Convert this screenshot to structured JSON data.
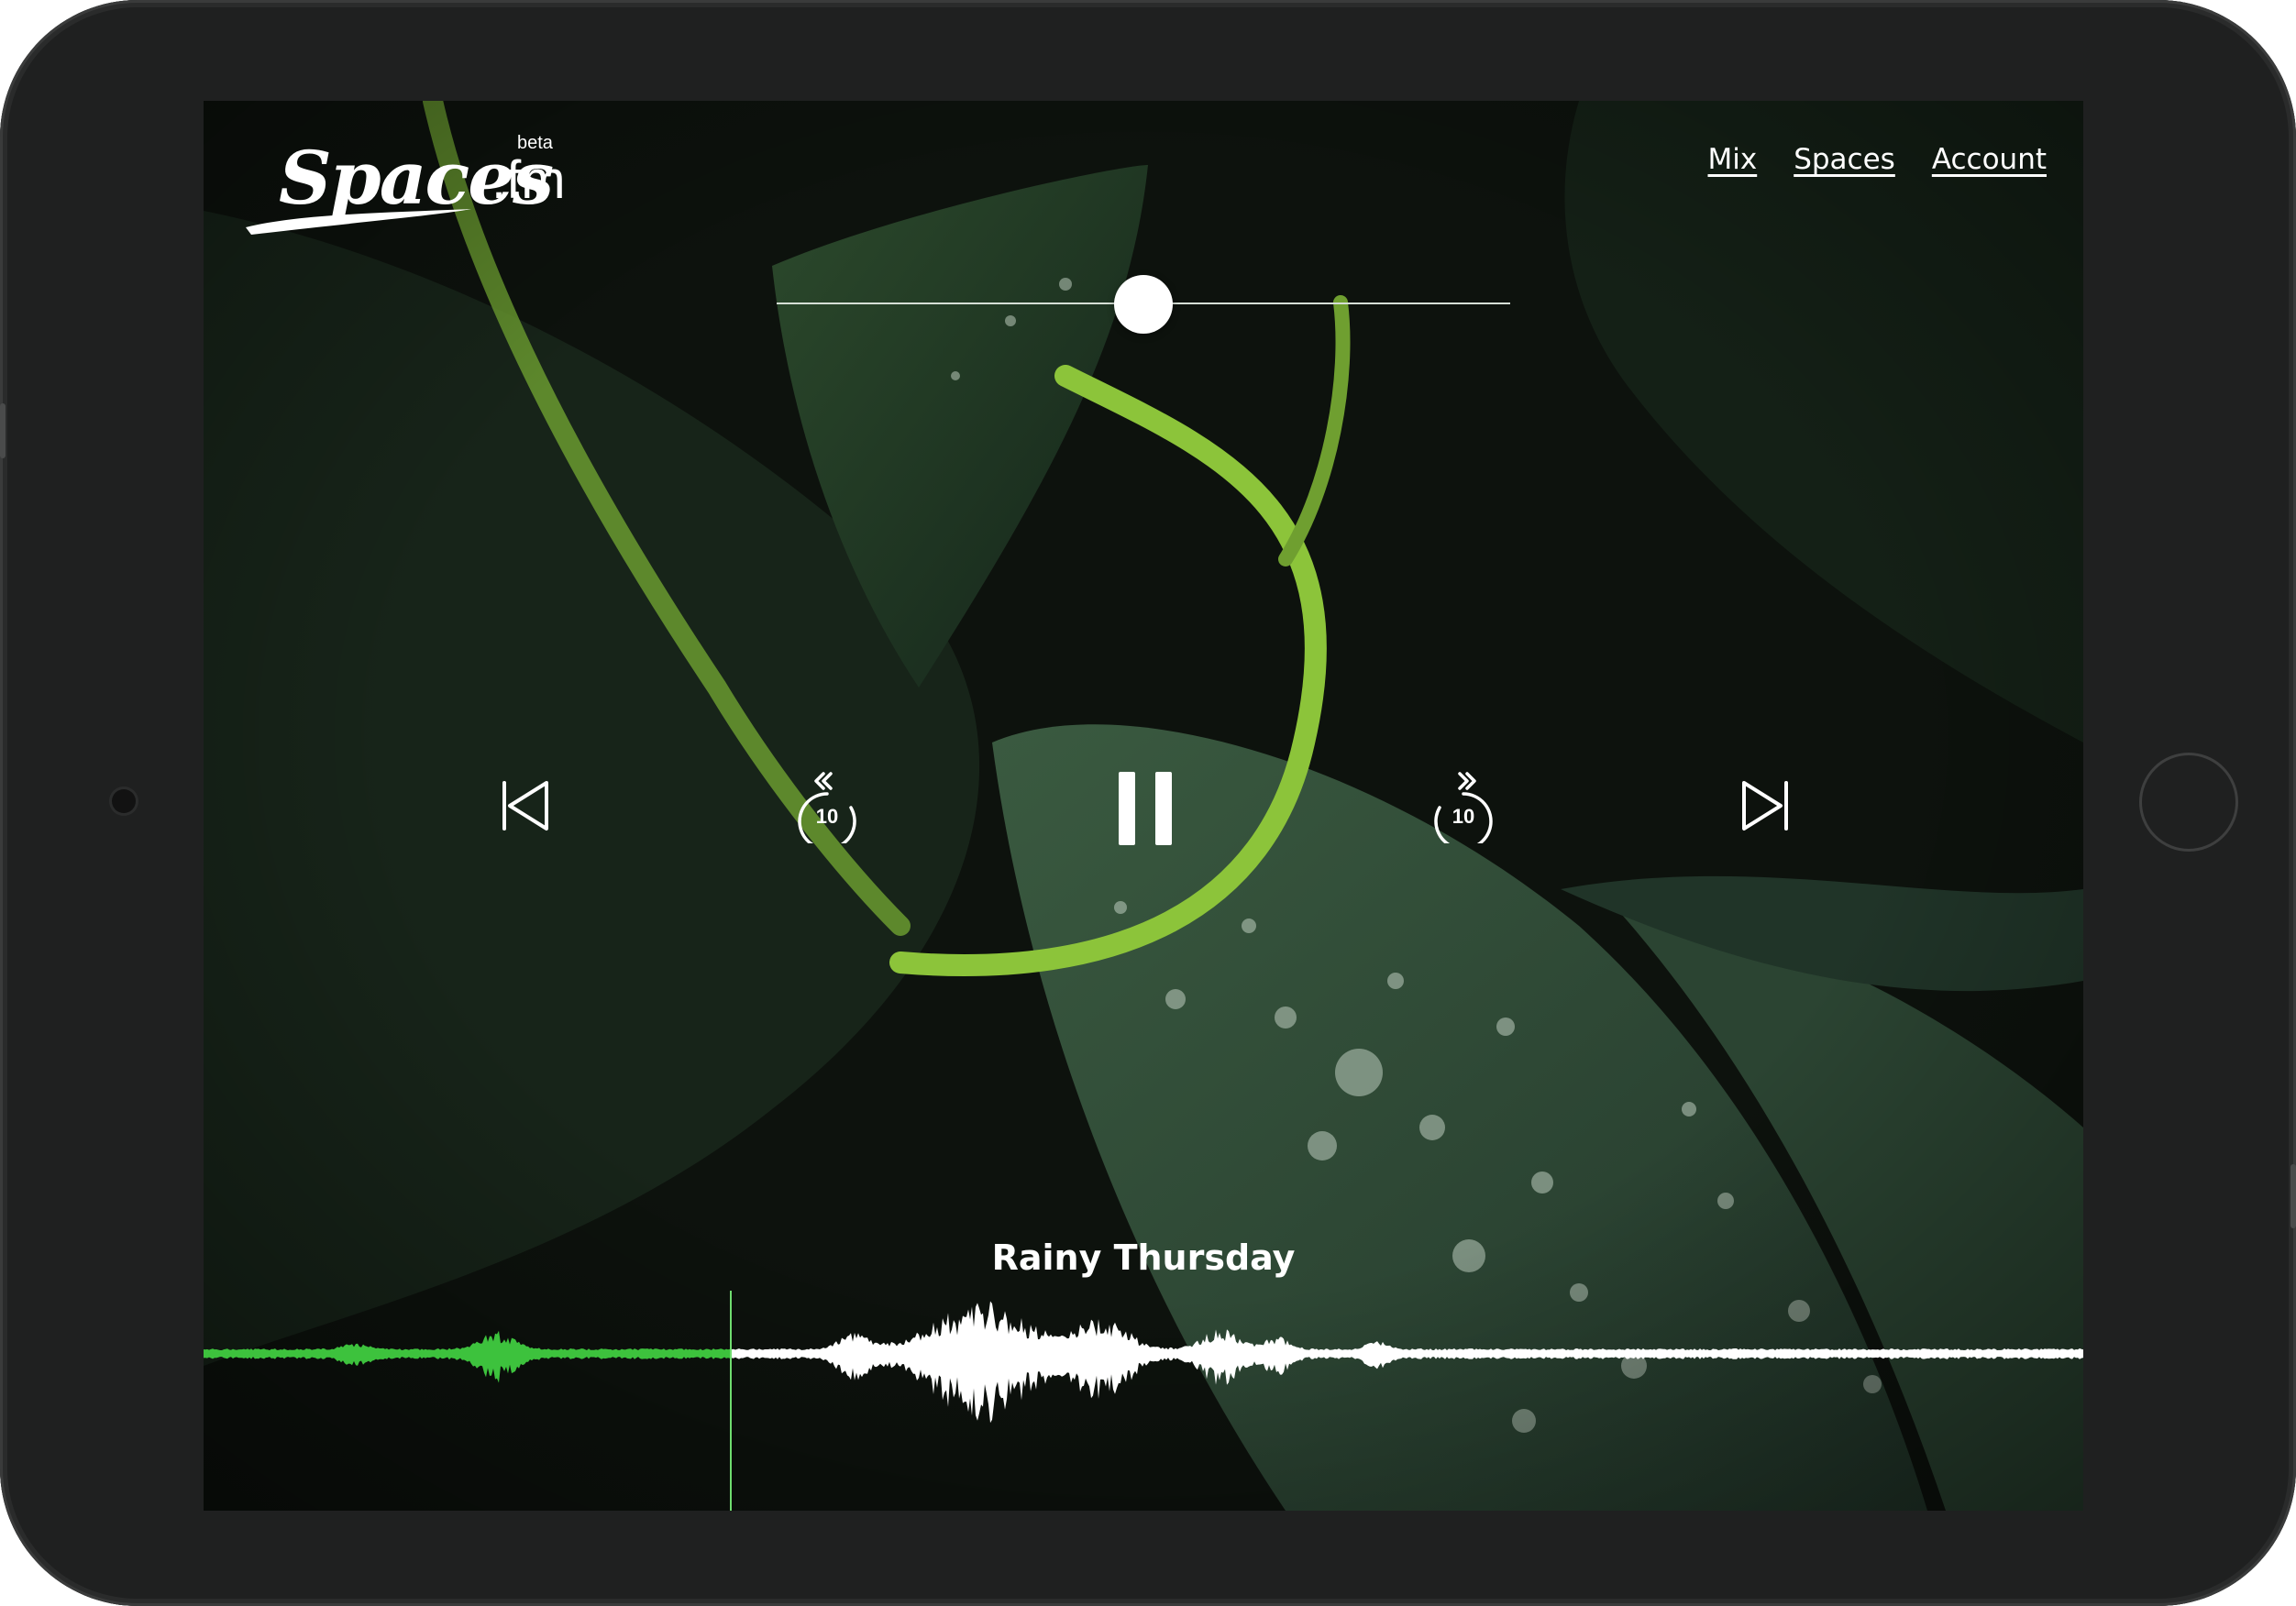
{
  "brand": {
    "name": "Spaces",
    "suffix": ".fm",
    "badge": "beta"
  },
  "nav": {
    "items": [
      {
        "label": "Mix"
      },
      {
        "label": "Spaces"
      },
      {
        "label": "Account"
      }
    ]
  },
  "volume": {
    "level": 0.5
  },
  "controls": {
    "previous_icon": "skip-previous-icon",
    "rewind_icon": "rewind-10-icon",
    "rewind_seconds": "10",
    "pause_icon": "pause-icon",
    "forward_icon": "forward-10-icon",
    "forward_seconds": "10",
    "next_icon": "skip-next-icon"
  },
  "track": {
    "title": "Rainy Thursday",
    "progress": 0.28
  },
  "colors": {
    "played": "#3dc23d",
    "unplayed": "#ffffff",
    "playhead": "#6fdc6f"
  }
}
